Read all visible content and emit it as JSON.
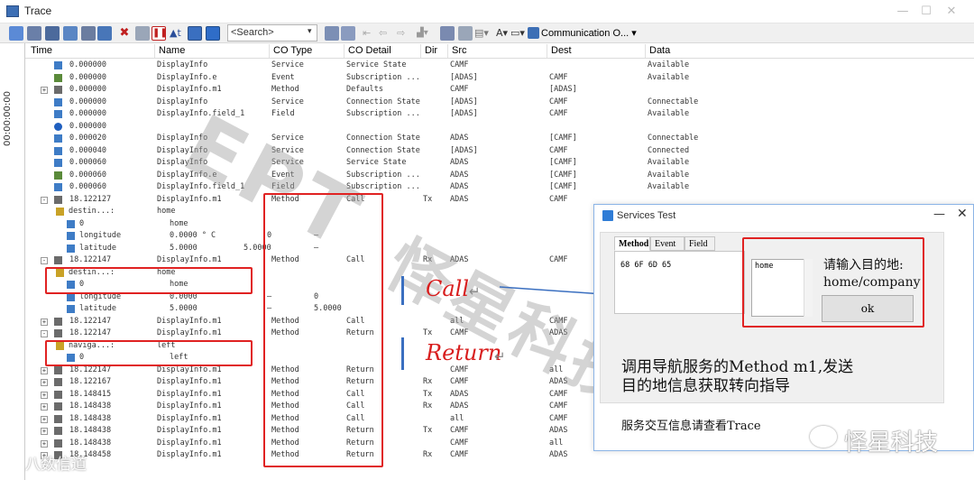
{
  "window": {
    "title": "Trace"
  },
  "toolbar": {
    "search_placeholder": "<Search>",
    "comm_label": "Communication O..."
  },
  "sidebar": {
    "time_label": "00:00:00:00"
  },
  "columns": [
    "Time",
    "Name",
    "CO Type",
    "CO Detail",
    "Dir",
    "Src",
    "Dest",
    "Data"
  ],
  "rows": [
    {
      "icon": "service",
      "exp": "",
      "time": "0.000000",
      "name": "DisplayInfo",
      "cotype": "Service",
      "detail": "Service State",
      "dir": "",
      "src": "CAMF",
      "dest": "",
      "data": "Available"
    },
    {
      "icon": "event",
      "exp": "",
      "time": "0.000000",
      "name": "DisplayInfo.e",
      "cotype": "Event",
      "detail": "Subscription ...",
      "dir": "",
      "src": "[ADAS]",
      "dest": "CAMF",
      "data": "Available"
    },
    {
      "icon": "method",
      "exp": "+",
      "time": "0.000000",
      "name": "DisplayInfo.m1",
      "cotype": "Method",
      "detail": "Defaults",
      "dir": "",
      "src": "CAMF",
      "dest": "[ADAS]",
      "data": ""
    },
    {
      "icon": "service",
      "exp": "",
      "time": "0.000000",
      "name": "DisplayInfo",
      "cotype": "Service",
      "detail": "Connection State",
      "dir": "",
      "src": "[ADAS]",
      "dest": "CAMF",
      "data": "Connectable"
    },
    {
      "icon": "field",
      "exp": "",
      "time": "0.000000",
      "name": "DisplayInfo.field_1",
      "cotype": "Field",
      "detail": "Subscription ...",
      "dir": "",
      "src": "[ADAS]",
      "dest": "CAMF",
      "data": "Available"
    },
    {
      "icon": "info",
      "exp": "",
      "time": "0.000000",
      "name": "",
      "cotype": "",
      "detail": "",
      "dir": "",
      "src": "",
      "dest": "",
      "data": ""
    },
    {
      "icon": "service",
      "exp": "",
      "time": "0.000020",
      "name": "DisplayInfo",
      "cotype": "Service",
      "detail": "Connection State",
      "dir": "",
      "src": "ADAS",
      "dest": "[CAMF]",
      "data": "Connectable"
    },
    {
      "icon": "service",
      "exp": "",
      "time": "0.000040",
      "name": "DisplayInfo",
      "cotype": "Service",
      "detail": "Connection State",
      "dir": "",
      "src": "[ADAS]",
      "dest": "CAMF",
      "data": "Connected"
    },
    {
      "icon": "service",
      "exp": "",
      "time": "0.000060",
      "name": "DisplayInfo",
      "cotype": "Service",
      "detail": "Service State",
      "dir": "",
      "src": "ADAS",
      "dest": "[CAMF]",
      "data": "Available"
    },
    {
      "icon": "event",
      "exp": "",
      "time": "0.000060",
      "name": "DisplayInfo.e",
      "cotype": "Event",
      "detail": "Subscription ...",
      "dir": "",
      "src": "ADAS",
      "dest": "[CAMF]",
      "data": "Available"
    },
    {
      "icon": "field",
      "exp": "",
      "time": "0.000060",
      "name": "DisplayInfo.field_1",
      "cotype": "Field",
      "detail": "Subscription ...",
      "dir": "",
      "src": "ADAS",
      "dest": "[CAMF]",
      "data": "Available"
    },
    {
      "icon": "method",
      "exp": "-",
      "time": "18.122127",
      "name": "DisplayInfo.m1",
      "cotype": "Method",
      "detail": "Call",
      "dir": "Tx",
      "src": "ADAS",
      "dest": "CAMF",
      "data": ""
    }
  ],
  "call1_children": [
    {
      "label": "destin...:",
      "value": "home",
      "sub": "0",
      "subval": "home"
    },
    {
      "label": "longitude",
      "value": "0.0000 ° C",
      "c3": "0",
      "c4": "–"
    },
    {
      "label": "latitude",
      "value": "5.0000",
      "c2": "5.0000",
      "c4": "–"
    }
  ],
  "row_rx": {
    "time": "18.122147",
    "name": "DisplayInfo.m1",
    "cotype": "Method",
    "detail": "Call",
    "dir": "Rx",
    "src": "ADAS",
    "dest": "CAMF"
  },
  "call2_children": [
    {
      "label": "destin...:",
      "value": "home",
      "sub": "0",
      "subval": "home"
    },
    {
      "label": "longitude",
      "value": "0.0000",
      "c3": "–",
      "c4": "0"
    },
    {
      "label": "latitude",
      "value": "5.0000",
      "c3": "–",
      "c4": "5.0000"
    }
  ],
  "rows2": [
    {
      "time": "18.122147",
      "name": "DisplayInfo.m1",
      "cotype": "Method",
      "detail": "Call",
      "dir": "",
      "src": "all",
      "dest": "CAMF"
    },
    {
      "time": "18.122147",
      "name": "DisplayInfo.m1",
      "cotype": "Method",
      "detail": "Return",
      "dir": "Tx",
      "src": "CAMF",
      "dest": "ADAS"
    }
  ],
  "ret_children": {
    "label": "naviga...:",
    "value": "left",
    "sub": "0",
    "subval": "left"
  },
  "rows3": [
    {
      "time": "18.122147",
      "name": "DisplayInfo.m1",
      "cotype": "Method",
      "detail": "Return",
      "dir": "",
      "src": "CAMF",
      "dest": "all"
    },
    {
      "time": "18.122167",
      "name": "DisplayInfo.m1",
      "cotype": "Method",
      "detail": "Return",
      "dir": "Rx",
      "src": "CAMF",
      "dest": "ADAS"
    },
    {
      "time": "18.148415",
      "name": "DisplayInfo.m1",
      "cotype": "Method",
      "detail": "Call",
      "dir": "Tx",
      "src": "ADAS",
      "dest": "CAMF"
    },
    {
      "time": "18.148438",
      "name": "DisplayInfo.m1",
      "cotype": "Method",
      "detail": "Call",
      "dir": "Rx",
      "src": "ADAS",
      "dest": "CAMF"
    },
    {
      "time": "18.148438",
      "name": "DisplayInfo.m1",
      "cotype": "Method",
      "detail": "Call",
      "dir": "",
      "src": "all",
      "dest": "CAMF"
    },
    {
      "time": "18.148438",
      "name": "DisplayInfo.m1",
      "cotype": "Method",
      "detail": "Return",
      "dir": "Tx",
      "src": "CAMF",
      "dest": "ADAS"
    },
    {
      "time": "18.148438",
      "name": "DisplayInfo.m1",
      "cotype": "Method",
      "detail": "Return",
      "dir": "",
      "src": "CAMF",
      "dest": "all"
    },
    {
      "time": "18.148458",
      "name": "DisplayInfo.m1",
      "cotype": "Method",
      "detail": "Return",
      "dir": "Rx",
      "src": "CAMF",
      "dest": "ADAS"
    }
  ],
  "annotations": {
    "call": "Call",
    "return": "Return",
    "mark": "↵"
  },
  "dialog": {
    "title": "Services Test",
    "tabs": [
      "Method",
      "Event",
      "Field"
    ],
    "hex": "68 6F 6D 65",
    "input_value": "home",
    "prompt_line1": "请输入目的地:",
    "prompt_line2": "home/company",
    "ok_label": "ok",
    "desc_line1": "调用导航服务的Method m1,发送",
    "desc_line2": "目的地信息获取转向指导",
    "note": "服务交互信息请查看Trace"
  },
  "watermark": {
    "logo": "怿星科技",
    "bottom_left": "八数信道"
  },
  "colors": {
    "red_box": "#e02222",
    "blue": "#3a6fc0",
    "annotation_red": "#d81e1e"
  }
}
